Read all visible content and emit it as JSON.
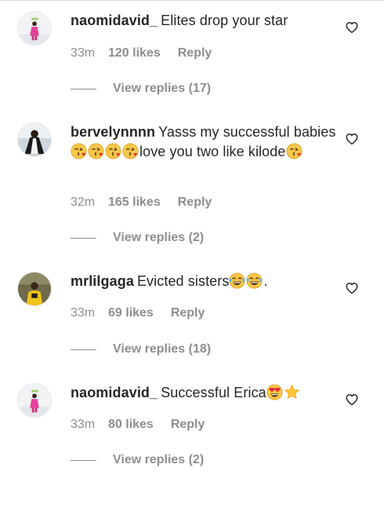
{
  "comments": [
    {
      "username": "naomidavid_",
      "text": "Elites drop your star",
      "time": "33m",
      "likes": "120 likes",
      "reply": "Reply",
      "replies": "View replies (17)"
    },
    {
      "username": "bervelynnnn",
      "text_a": "Yasss my successful babies",
      "text_b": "love you two like kilode",
      "time": "32m",
      "likes": "165 likes",
      "reply": "Reply",
      "replies": "View replies (2)"
    },
    {
      "username": "mrlilgaga",
      "text": "Evicted sisters",
      "text_end": ".",
      "time": "33m",
      "likes": "69 likes",
      "reply": "Reply",
      "replies": "View replies (18)"
    },
    {
      "username": "naomidavid_",
      "text": "Successful Erica",
      "time": "33m",
      "likes": "80 likes",
      "reply": "Reply",
      "replies": "View replies (2)"
    }
  ]
}
